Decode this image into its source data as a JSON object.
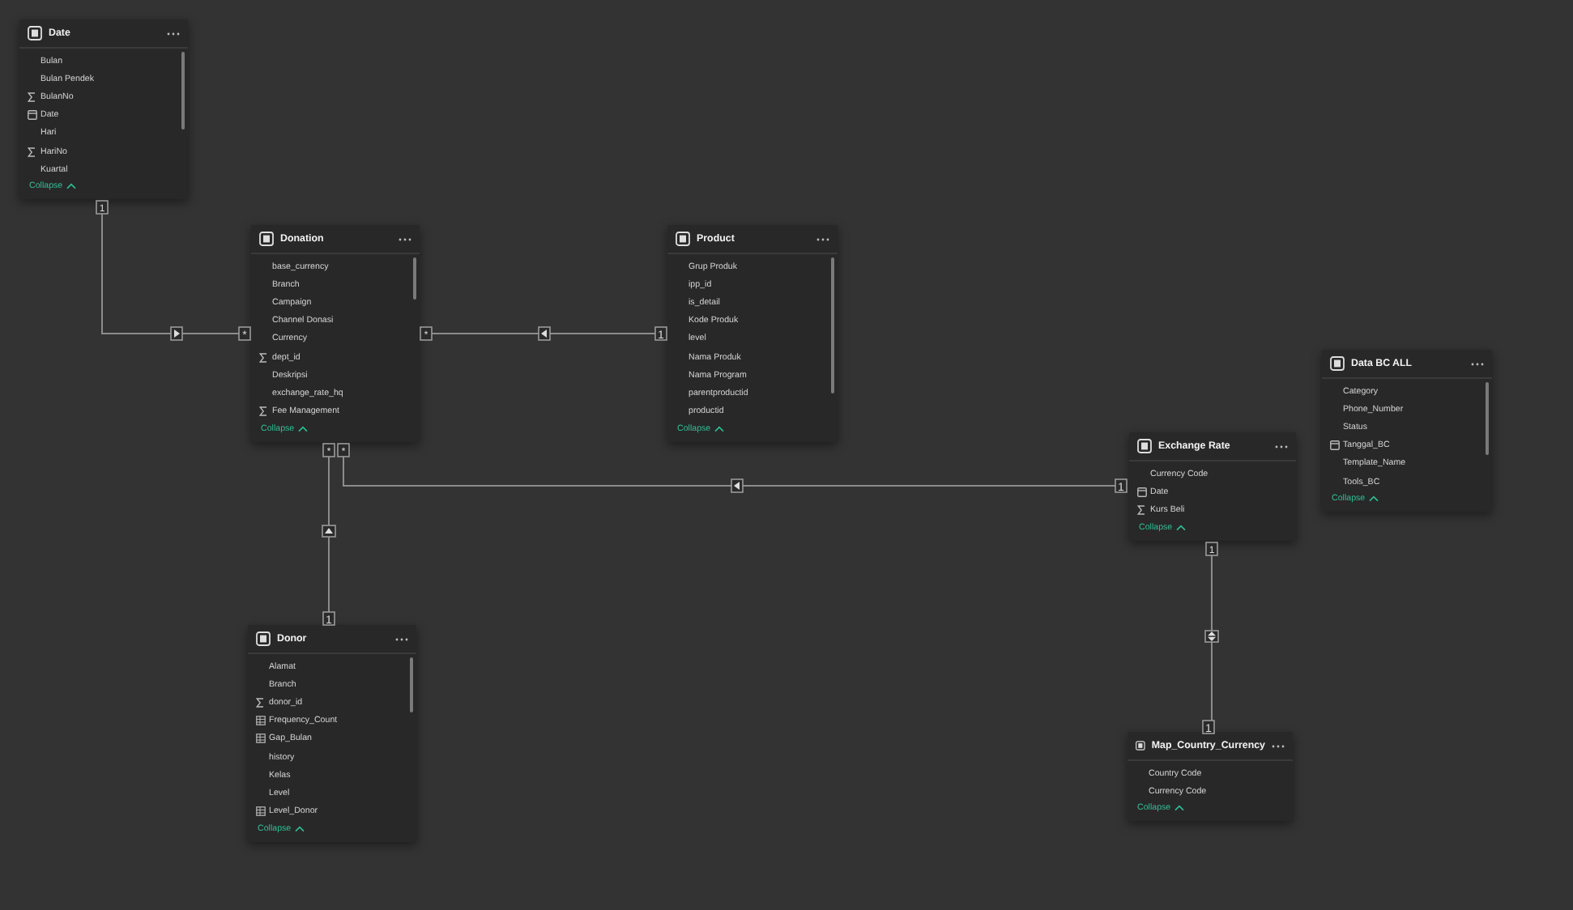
{
  "tables": [
    {
      "name": "Date",
      "collapse": "Collapse",
      "fields": [
        {
          "name": "Bulan",
          "kind": "plain"
        },
        {
          "name": "Bulan Pendek",
          "kind": "plain"
        },
        {
          "name": "BulanNo",
          "kind": "sum"
        },
        {
          "name": "Date",
          "kind": "date"
        },
        {
          "name": "Hari",
          "kind": "plain"
        },
        {
          "name": "HariNo",
          "kind": "sum"
        },
        {
          "name": "Kuartal",
          "kind": "plain"
        }
      ]
    },
    {
      "name": "Donation",
      "collapse": "Collapse",
      "fields": [
        {
          "name": "base_currency",
          "kind": "plain"
        },
        {
          "name": "Branch",
          "kind": "plain"
        },
        {
          "name": "Campaign",
          "kind": "plain"
        },
        {
          "name": "Channel Donasi",
          "kind": "plain"
        },
        {
          "name": "Currency",
          "kind": "plain"
        },
        {
          "name": "dept_id",
          "kind": "sum"
        },
        {
          "name": "Deskripsi",
          "kind": "plain"
        },
        {
          "name": "exchange_rate_hq",
          "kind": "plain"
        },
        {
          "name": "Fee Management",
          "kind": "sum"
        }
      ]
    },
    {
      "name": "Product",
      "collapse": "Collapse",
      "fields": [
        {
          "name": "Grup Produk",
          "kind": "plain"
        },
        {
          "name": "ipp_id",
          "kind": "plain"
        },
        {
          "name": "is_detail",
          "kind": "plain"
        },
        {
          "name": "Kode Produk",
          "kind": "plain"
        },
        {
          "name": "level",
          "kind": "plain"
        },
        {
          "name": "Nama Produk",
          "kind": "plain"
        },
        {
          "name": "Nama Program",
          "kind": "plain"
        },
        {
          "name": "parentproductid",
          "kind": "plain"
        },
        {
          "name": "productid",
          "kind": "plain"
        }
      ]
    },
    {
      "name": "Donor",
      "collapse": "Collapse",
      "fields": [
        {
          "name": "Alamat",
          "kind": "plain"
        },
        {
          "name": "Branch",
          "kind": "plain"
        },
        {
          "name": "donor_id",
          "kind": "sum"
        },
        {
          "name": "Frequency_Count",
          "kind": "calc"
        },
        {
          "name": "Gap_Bulan",
          "kind": "calc"
        },
        {
          "name": "history",
          "kind": "plain"
        },
        {
          "name": "Kelas",
          "kind": "plain"
        },
        {
          "name": "Level",
          "kind": "plain"
        },
        {
          "name": "Level_Donor",
          "kind": "calc"
        }
      ]
    },
    {
      "name": "Exchange Rate",
      "collapse": "Collapse",
      "fields": [
        {
          "name": "Currency Code",
          "kind": "plain"
        },
        {
          "name": "Date",
          "kind": "date"
        },
        {
          "name": "Kurs Beli",
          "kind": "sum"
        }
      ]
    },
    {
      "name": "Map_Country_Currency",
      "collapse": "Collapse",
      "fields": [
        {
          "name": "Country Code",
          "kind": "plain"
        },
        {
          "name": "Currency Code",
          "kind": "plain"
        }
      ]
    },
    {
      "name": "Data BC ALL",
      "collapse": "Collapse",
      "fields": [
        {
          "name": "Category",
          "kind": "plain"
        },
        {
          "name": "Phone_Number",
          "kind": "plain"
        },
        {
          "name": "Status",
          "kind": "plain"
        },
        {
          "name": "Tanggal_BC",
          "kind": "date"
        },
        {
          "name": "Template_Name",
          "kind": "plain"
        },
        {
          "name": "Tools_BC",
          "kind": "plain"
        }
      ]
    }
  ],
  "relationships": [
    {
      "start": "1",
      "end": "*",
      "kind": "single"
    },
    {
      "start": "*",
      "end": "1",
      "kind": "single"
    },
    {
      "start": "*",
      "end": "1",
      "kind": "single"
    },
    {
      "start": "*",
      "end": "1",
      "kind": "single"
    },
    {
      "start": "1",
      "end": "1",
      "kind": "both"
    }
  ]
}
